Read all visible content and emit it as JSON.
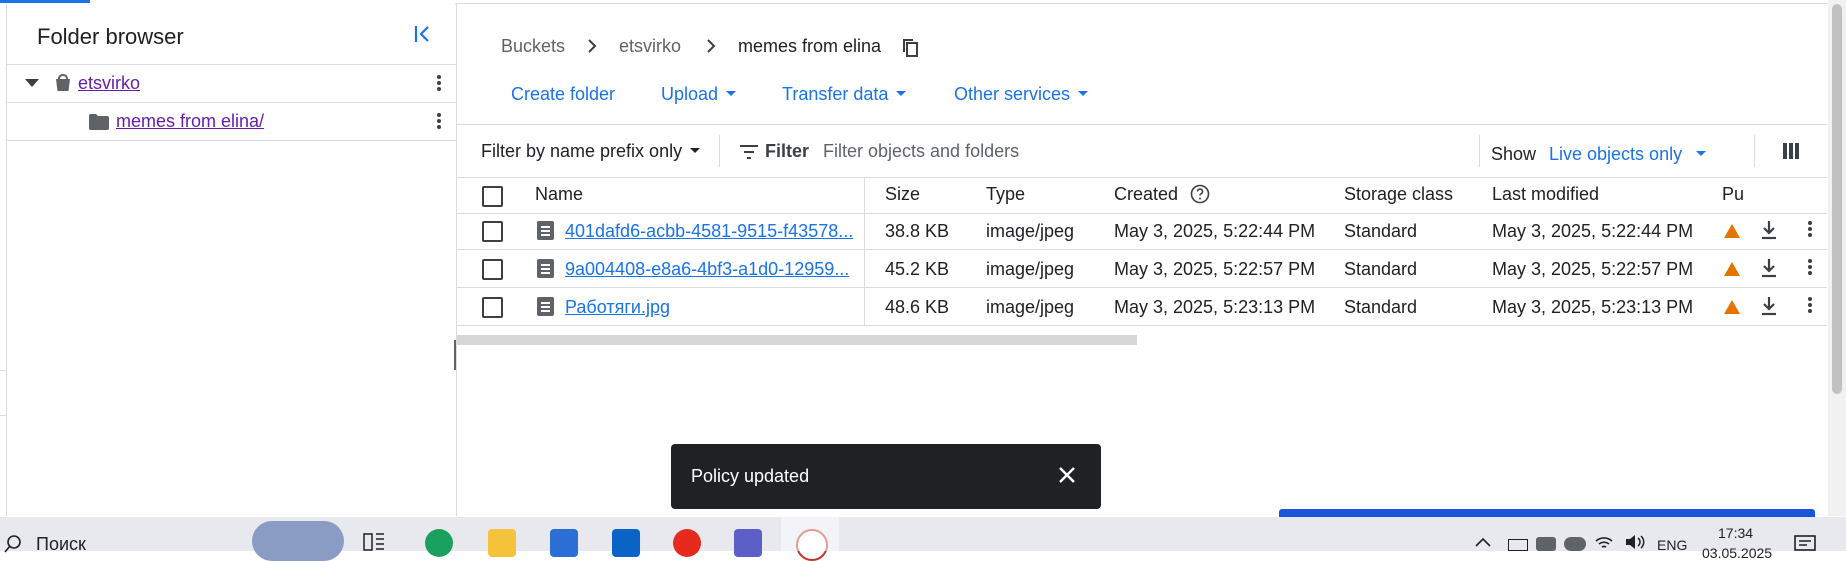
{
  "folder_browser": {
    "title": "Folder browser",
    "tree": [
      {
        "label": "etsvirko"
      },
      {
        "label": "memes from elina/"
      }
    ]
  },
  "breadcrumbs": [
    "Buckets",
    "etsvirko",
    "memes from elina"
  ],
  "actions": {
    "create_folder": "Create folder",
    "upload": "Upload",
    "transfer": "Transfer data",
    "other": "Other services"
  },
  "filter_bar": {
    "prefix_select": "Filter by name prefix only",
    "filter_label": "Filter",
    "filter_placeholder": "Filter objects and folders",
    "show_label": "Show",
    "show_value": "Live objects only"
  },
  "table": {
    "columns": [
      "Name",
      "Size",
      "Type",
      "Created",
      "Storage class",
      "Last modified",
      "Pu"
    ],
    "rows": [
      {
        "name": "401dafd6-acbb-4581-9515-f43578...",
        "size": "38.8 KB",
        "type": "image/jpeg",
        "created": "May 3, 2025, 5:22:44 PM",
        "storage": "Standard",
        "modified": "May 3, 2025, 5:22:44 PM"
      },
      {
        "name": "9a004408-e8a6-4bf3-a1d0-12959...",
        "size": "45.2 KB",
        "type": "image/jpeg",
        "created": "May 3, 2025, 5:22:57 PM",
        "storage": "Standard",
        "modified": "May 3, 2025, 5:22:57 PM"
      },
      {
        "name": "Работяги.jpg",
        "size": "48.6 KB",
        "type": "image/jpeg",
        "created": "May 3, 2025, 5:23:13 PM",
        "storage": "Standard",
        "modified": "May 3, 2025, 5:23:13 PM"
      }
    ]
  },
  "toast": {
    "message": "Policy updated"
  },
  "taskbar": {
    "search": "Поиск",
    "lang": "ENG",
    "time": "17:34",
    "date": "03.05.2025"
  },
  "colors": {
    "accent": "#1a73e8",
    "visited": "#681da8",
    "warning": "#e37400"
  }
}
